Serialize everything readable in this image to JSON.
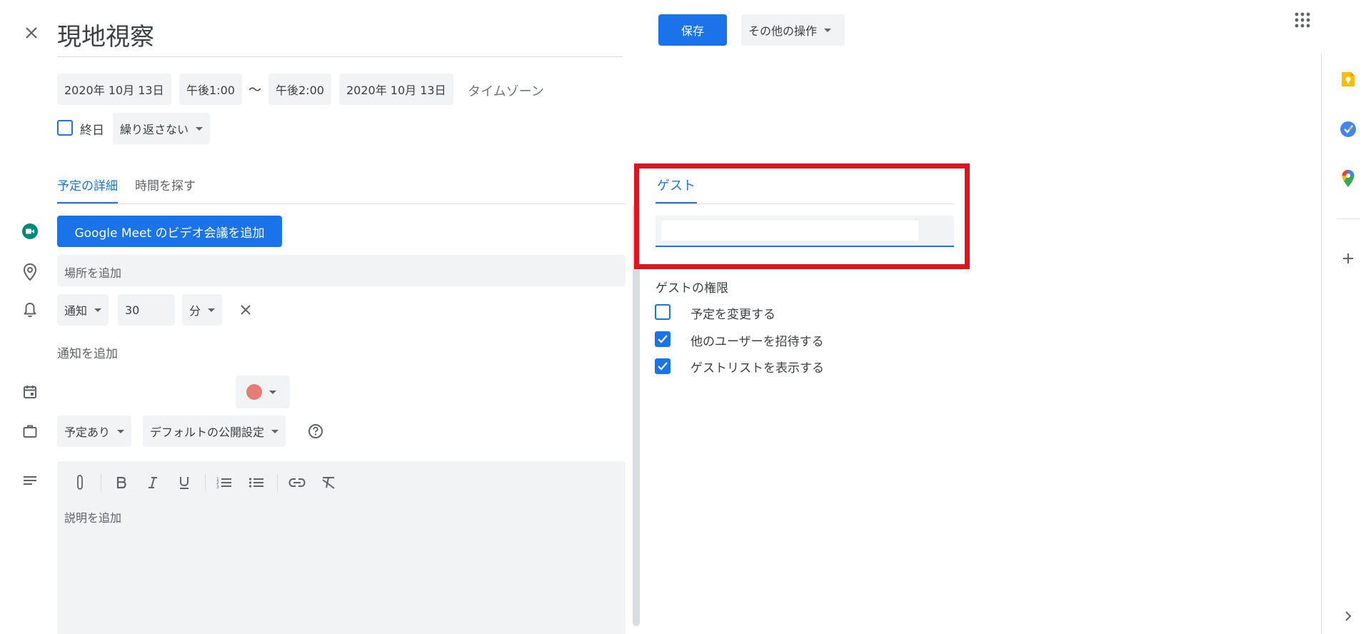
{
  "header": {
    "title": "現地視察",
    "save_label": "保存",
    "more_actions_label": "その他の操作"
  },
  "datetime": {
    "start_date": "2020年 10月 13日",
    "start_time": "午後1:00",
    "separator": "〜",
    "end_time": "午後2:00",
    "end_date": "2020年 10月 13日",
    "timezone_label": "タイムゾーン",
    "all_day_label": "終日",
    "all_day_checked": false,
    "repeat_label": "繰り返さない"
  },
  "tabs": [
    {
      "label": "予定の詳細",
      "active": true
    },
    {
      "label": "時間を探す",
      "active": false
    }
  ],
  "details": {
    "meet_button_label": "Google Meet のビデオ会議を追加",
    "location_placeholder": "場所を追加",
    "notification_type": "通知",
    "notification_value": "30",
    "notification_unit": "分",
    "add_notification_label": "通知を追加",
    "event_color": "#e67c73",
    "availability_label": "予定あり",
    "visibility_label": "デフォルトの公開設定",
    "description_placeholder": "説明を追加"
  },
  "guests": {
    "tab_label": "ゲスト",
    "input_placeholder": "",
    "permissions_title": "ゲストの権限",
    "permissions": [
      {
        "label": "予定を変更する",
        "checked": false
      },
      {
        "label": "他のユーザーを招待する",
        "checked": true
      },
      {
        "label": "ゲストリストを表示する",
        "checked": true
      }
    ]
  },
  "colors": {
    "accent": "#1a73e8",
    "highlight": "#e0141e",
    "chip_bg": "#f1f3f4"
  },
  "icons": {
    "close": "close-icon",
    "apps": "apps-grid-icon",
    "meet": "google-meet-icon",
    "location": "location-pin-icon",
    "notification": "bell-icon",
    "calendar": "calendar-icon",
    "busy": "briefcase-icon",
    "description": "description-icon",
    "keep": "google-keep-icon",
    "tasks": "google-tasks-icon",
    "maps": "google-maps-icon",
    "add_addon": "plus-icon",
    "expand_panel": "chevron-right-icon"
  }
}
